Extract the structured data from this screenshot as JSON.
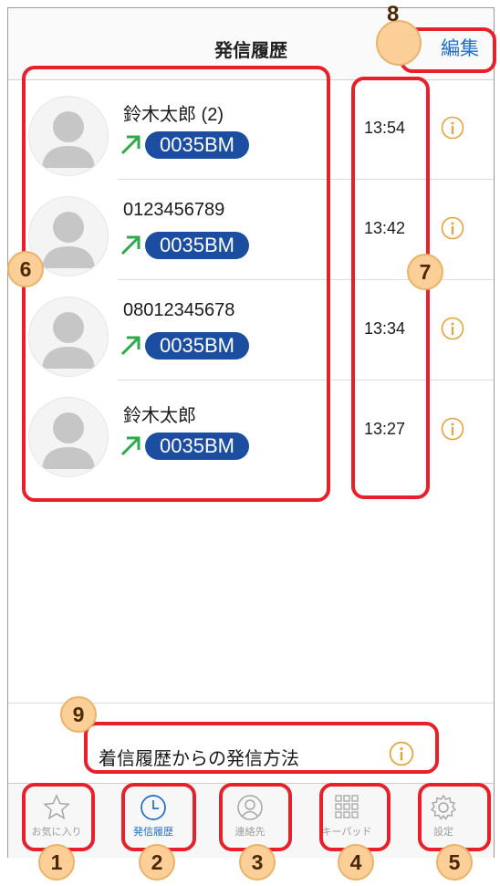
{
  "header": {
    "title": "発信履歴",
    "edit_label": "編集"
  },
  "calls": [
    {
      "name": "鈴木太郎 (2)",
      "line": "0035BM",
      "time": "13:54"
    },
    {
      "name": "0123456789",
      "line": "0035BM",
      "time": "13:42"
    },
    {
      "name": "08012345678",
      "line": "0035BM",
      "time": "13:34"
    },
    {
      "name": "鈴木太郎",
      "line": "0035BM",
      "time": "13:27"
    }
  ],
  "howto": {
    "label": "着信履歴からの発信方法"
  },
  "tabs": [
    {
      "label": "お気に入り",
      "icon": "star-icon"
    },
    {
      "label": "発信履歴",
      "icon": "clock-icon"
    },
    {
      "label": "連絡先",
      "icon": "contact-icon"
    },
    {
      "label": "キーパッド",
      "icon": "keypad-icon"
    },
    {
      "label": "設定",
      "icon": "gear-icon"
    }
  ],
  "callouts": [
    "1",
    "2",
    "3",
    "4",
    "5",
    "6",
    "7",
    "8",
    "9"
  ],
  "colors": {
    "accent": "#1e6ec8",
    "badge": "#1b4da1",
    "outgoing_arrow": "#2eaa4a",
    "info": "#e8a23a",
    "highlight": "#e8202a",
    "callout": "#fbcf97"
  }
}
